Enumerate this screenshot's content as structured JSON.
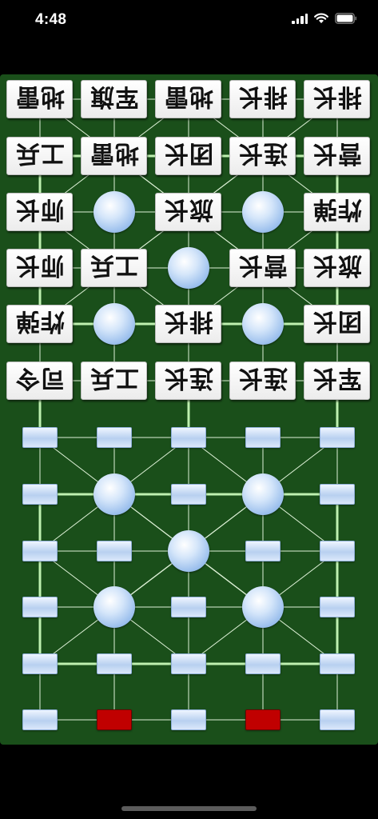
{
  "status_bar": {
    "time": "4:48",
    "icons": [
      "signal-icon",
      "wifi-icon",
      "battery-icon"
    ]
  },
  "board": {
    "colors": {
      "felt": "#1a4f1a",
      "rail": "#bff0b0",
      "road": "#dff2d8",
      "hq": "#c00000"
    },
    "opponent_pieces": [
      [
        "地雷",
        "军旗",
        "地雷",
        "排长",
        "排长"
      ],
      [
        "工兵",
        "地雷",
        "团长",
        "连长",
        "营长"
      ],
      [
        "师长",
        null,
        "旅长",
        null,
        "炸弹"
      ],
      [
        "师长",
        "工兵",
        null,
        "营长",
        "旅长"
      ],
      [
        "炸弹",
        null,
        "排长",
        null,
        "团长"
      ],
      [
        "司令",
        "工兵",
        "连长",
        "连长",
        "军长"
      ]
    ],
    "player_rows": [
      [
        "slot",
        "slot",
        "slot",
        "slot",
        "slot"
      ],
      [
        "slot",
        "camp",
        "slot",
        "camp",
        "slot"
      ],
      [
        "slot",
        "slot",
        "camp",
        "slot",
        "slot"
      ],
      [
        "slot",
        "camp",
        "slot",
        "camp",
        "slot"
      ],
      [
        "slot",
        "slot",
        "slot",
        "slot",
        "slot"
      ],
      [
        "slot",
        "hq",
        "slot",
        "hq",
        "slot"
      ]
    ]
  }
}
